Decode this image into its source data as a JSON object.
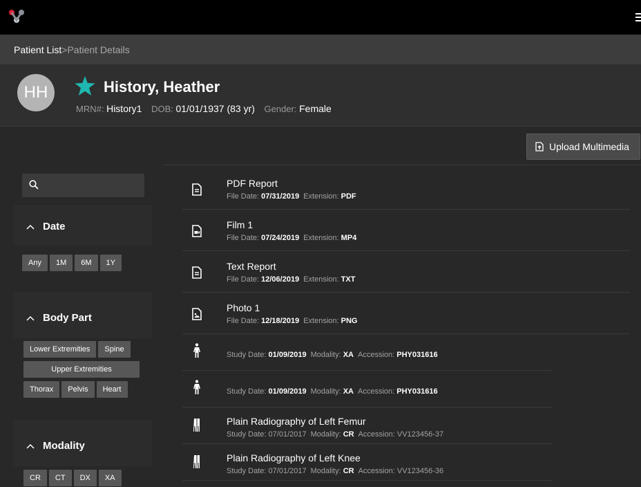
{
  "header": {
    "logo": "app-logo",
    "menu_icon": "hamburger-icon"
  },
  "breadcrumb": {
    "parent": "Patient List",
    "separator": ">",
    "current": "Patient Details"
  },
  "patient": {
    "initials": "HH",
    "favorite_icon": "star-icon",
    "favorite_color": "#1fb8b0",
    "name": "History, Heather",
    "mrn_label": "MRN#:",
    "mrn": "History1",
    "dob_label": "DOB:",
    "dob": "01/01/1937 (83 yr)",
    "gender_label": "Gender:",
    "gender": "Female"
  },
  "actions": {
    "upload_label": "Upload Multimedia",
    "upload_icon": "file-upload-icon"
  },
  "search": {
    "placeholder": "",
    "icon": "search-icon"
  },
  "filters": {
    "date": {
      "title": "Date",
      "options": [
        "Any",
        "1M",
        "6M",
        "1Y"
      ]
    },
    "body_part": {
      "title": "Body Part",
      "options": [
        "Lower Extremities",
        "Spine",
        "Upper Extremities",
        "Thorax",
        "Pelvis",
        "Heart"
      ]
    },
    "modality": {
      "title": "Modality",
      "options": [
        "CR",
        "CT",
        "DX",
        "XA"
      ]
    }
  },
  "labels": {
    "file_date": "File Date:",
    "extension": "Extension:",
    "study_date": "Study Date:",
    "modality": "Modality:",
    "accession": "Accession:"
  },
  "files": [
    {
      "name": "PDF Report",
      "icon": "document-icon",
      "date": "07/31/2019",
      "extension": "PDF"
    },
    {
      "name": "Film 1",
      "icon": "video-file-icon",
      "date": "07/24/2019",
      "extension": "MP4"
    },
    {
      "name": "Text Report",
      "icon": "document-icon",
      "date": "12/06/2019",
      "extension": "TXT"
    },
    {
      "name": "Photo 1",
      "icon": "image-file-icon",
      "date": "12/18/2019",
      "extension": "PNG"
    }
  ],
  "studies": [
    {
      "name": "",
      "icon": "body-figure-icon",
      "date": "01/09/2019",
      "modality": "XA",
      "accession": "PHY031616"
    },
    {
      "name": "",
      "icon": "body-figure-icon",
      "date": "01/09/2019",
      "modality": "XA",
      "accession": "PHY031616"
    },
    {
      "name": "Plain Radiography of Left Femur",
      "icon": "legs-icon",
      "date": "07/01/2017",
      "modality": "CR",
      "accession": "VV123456-37"
    },
    {
      "name": "Plain Radiography of Left Knee",
      "icon": "legs-icon",
      "date": "07/01/2017",
      "modality": "CR",
      "accession": "VV123456-36"
    }
  ]
}
